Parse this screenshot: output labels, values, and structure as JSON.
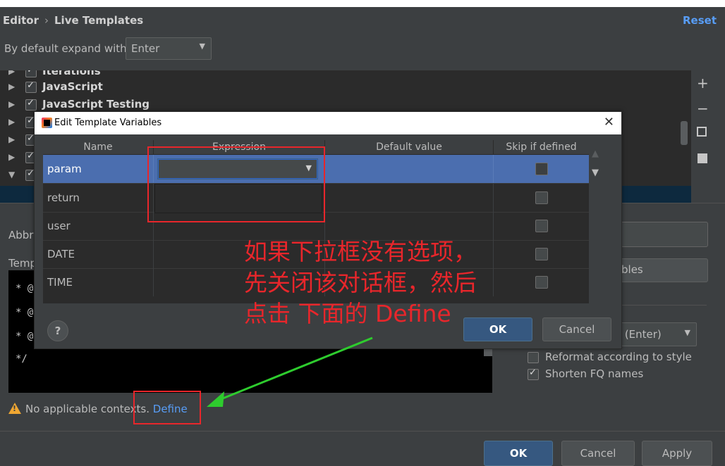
{
  "header": {
    "breadcrumb_parent": "Editor",
    "breadcrumb_sep": "›",
    "breadcrumb_current": "Live Templates",
    "reset_label": "Reset"
  },
  "expand": {
    "label": "By default expand with",
    "value": "Enter"
  },
  "tree": {
    "items": [
      {
        "label": "Iterations",
        "checked": true
      },
      {
        "label": "JavaScript",
        "checked": true
      },
      {
        "label": "JavaScript Testing",
        "checked": true
      }
    ]
  },
  "side_tools": {
    "add": "+",
    "remove": "−"
  },
  "background": {
    "abbr_label": "Abbr",
    "template_label": "Temp",
    "edit_vars_partial": "bles",
    "code_lines": [
      "* @",
      "* @",
      "* @",
      "*/"
    ],
    "expand_partial": "lt (Enter)",
    "reformat_label": "Reformat according to style",
    "shorten_label": "Shorten FQ names",
    "reformat_checked": false,
    "shorten_checked": true
  },
  "warning": {
    "text": "No applicable contexts.",
    "define_label": "Define"
  },
  "footer": {
    "ok_label": "OK",
    "cancel_label": "Cancel",
    "apply_label": "Apply"
  },
  "dialog": {
    "title": "Edit Template Variables",
    "columns": [
      "Name",
      "Expression",
      "Default value",
      "Skip if defined"
    ],
    "rows": [
      {
        "name": "param",
        "expression": "",
        "default": "",
        "skip": false,
        "selected": true
      },
      {
        "name": "return",
        "expression": "",
        "default": "",
        "skip": false
      },
      {
        "name": "user",
        "expression": "",
        "default": "",
        "skip": false
      },
      {
        "name": "DATE",
        "expression": "",
        "default": "",
        "skip": false
      },
      {
        "name": "TIME",
        "expression": "",
        "default": "",
        "skip": false
      }
    ],
    "help_label": "?",
    "ok_label": "OK",
    "cancel_label": "Cancel"
  },
  "annotation": {
    "lines": [
      "如果下拉框没有选项，",
      "先关闭该对话框，然后",
      "点击 下面的 Define"
    ],
    "color": "#e8262b"
  }
}
